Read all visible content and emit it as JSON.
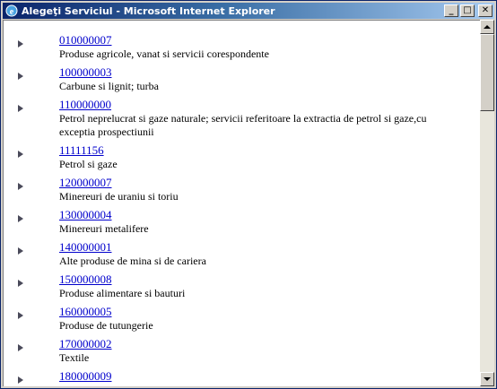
{
  "window": {
    "title": "Alegeţi Serviciul - Microsoft Internet Explorer",
    "buttons": {
      "minimize": "_",
      "maximize": "□",
      "close": "✕"
    }
  },
  "items": [
    {
      "code": "010000007",
      "desc": "Produse agricole, vanat si servicii corespondente"
    },
    {
      "code": "100000003",
      "desc": "Carbune si lignit; turba"
    },
    {
      "code": "110000000",
      "desc": "Petrol neprelucrat si gaze naturale; servicii referitoare la extractia de petrol si gaze,cu exceptia prospectiunii"
    },
    {
      "code": "11111156",
      "desc": "Petrol si gaze"
    },
    {
      "code": "120000007",
      "desc": "Minereuri de uraniu si toriu"
    },
    {
      "code": "130000004",
      "desc": "Minereuri metalifere"
    },
    {
      "code": "140000001",
      "desc": "Alte produse de mina si de cariera"
    },
    {
      "code": "150000008",
      "desc": "Produse alimentare si bauturi"
    },
    {
      "code": "160000005",
      "desc": "Produse de tutungerie"
    },
    {
      "code": "170000002",
      "desc": "Textile"
    },
    {
      "code": "180000009",
      "desc": ""
    }
  ]
}
